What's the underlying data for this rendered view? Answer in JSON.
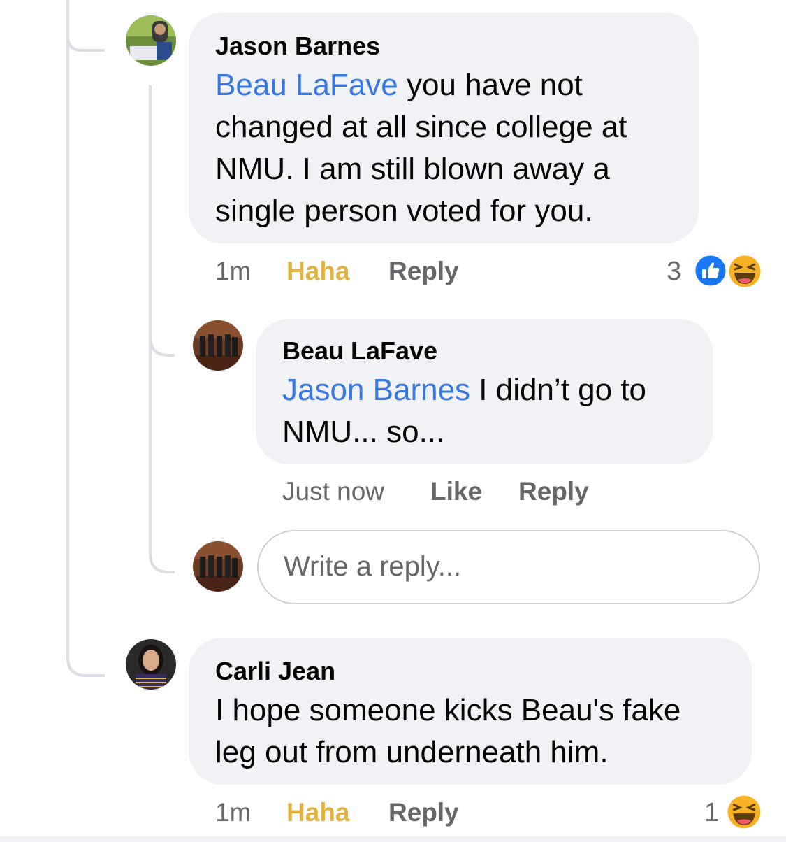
{
  "comments": [
    {
      "author": "Jason Barnes",
      "mention": "Beau LaFave",
      "text_line1_rest": " you have not",
      "text_line2": "changed at all since college at",
      "text_line3": "NMU. I am still blown away a",
      "text_line4": "single person voted for you.",
      "time": "1m",
      "reaction_action": "Haha",
      "reply_label": "Reply",
      "reaction_count": "3",
      "reactions": [
        "like-icon",
        "haha-icon"
      ]
    },
    {
      "author": "Carli Jean",
      "text_line1": "I hope someone kicks Beau's fake",
      "text_line2": "leg out from underneath him.",
      "time": "1m",
      "reaction_action": "Haha",
      "reply_label": "Reply",
      "reaction_count": "1",
      "reactions": [
        "haha-icon"
      ]
    }
  ],
  "reply": {
    "author": "Beau LaFave",
    "mention": "Jason Barnes",
    "text_line1_rest": " I didn’t go to",
    "text_line2": "NMU... so...",
    "time": "Just now",
    "like_label": "Like",
    "reply_label": "Reply"
  },
  "reply_input": {
    "placeholder": "Write a reply..."
  },
  "colors": {
    "mention": "#3578e5",
    "haha_label": "#e3b341",
    "bubble": "#f0f2f5",
    "meta": "#65676b"
  }
}
